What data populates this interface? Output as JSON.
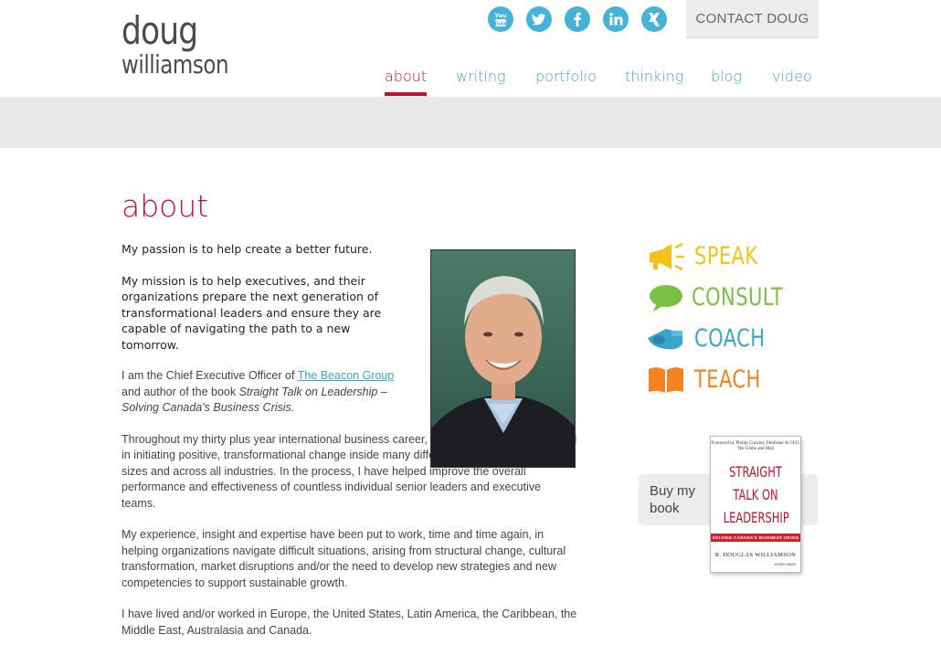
{
  "logo": {
    "line1": "doug",
    "line2": "williamson"
  },
  "social": [
    {
      "name": "youtube-icon",
      "glyph": "You Tube"
    },
    {
      "name": "twitter-icon",
      "glyph": ""
    },
    {
      "name": "facebook-icon",
      "glyph": "f"
    },
    {
      "name": "linkedin-icon",
      "glyph": "in"
    },
    {
      "name": "xing-icon",
      "glyph": ""
    }
  ],
  "contact_label": "CONTACT DOUG",
  "nav": [
    {
      "label": "about",
      "active": true
    },
    {
      "label": "writing",
      "active": false
    },
    {
      "label": "portfolio",
      "active": false
    },
    {
      "label": "thinking",
      "active": false
    },
    {
      "label": "blog",
      "active": false
    },
    {
      "label": "video",
      "active": false
    }
  ],
  "page_title": "about",
  "content": {
    "p1": "My passion is to help create a better future.",
    "p2": "My mission is to help executives, and their organizations prepare the next generation of transformational leaders and ensure they are capable of navigating the path to a new tomorrow.",
    "p3_before": "I am the Chief Executive Officer of ",
    "p3_link": "The Beacon Group",
    "p3_middle": " and author of the book ",
    "p3_book": "Straight Talk on Leadership – Solving Canada's Business Crisis.",
    "p4": "Throughout my thirty plus year international business career, I have been actively involved in initiating positive, transformational change inside many different organizations, of all sizes and across all industries. In the process, I have helped improve the overall performance and effectiveness of countless individual senior leaders and executive teams.",
    "p5": "My experience, insight and expertise have been put to work, time and time again, in helping organizations navigate difficult situations, arising from structural change, cultural transformation, market disruptions and/or the need to develop new strategies and new competencies to support sustainable growth.",
    "p6": "I have lived and/or worked in Europe, the United States, Latin America, the Caribbean, the Middle East, Australasia and Canada."
  },
  "services": [
    {
      "label": "SPEAK",
      "color": "#f2c21b",
      "icon": "megaphone-icon"
    },
    {
      "label": "CONSULT",
      "color": "#7ac143",
      "icon": "speech-bubble-icon"
    },
    {
      "label": "COACH",
      "color": "#3aa6cc",
      "icon": "whistle-icon"
    },
    {
      "label": "TEACH",
      "color": "#f58220",
      "icon": "book-icon"
    }
  ],
  "buy": {
    "label": "Buy my book"
  },
  "book_cover": {
    "foreword": "Foreword by Phillip Crawley, Publisher & CEO, The Globe and Mail",
    "title_lines": [
      "STRAIGHT",
      "TALK ON",
      "LEADERSHIP"
    ],
    "subtitle": "SOLVING CANADA'S BUSINESS CRISIS",
    "author": "R. DOUGLAS WILLIAMSON",
    "publisher": "JOSSEY-BASS"
  },
  "colors": {
    "accent_red": "#c8102e",
    "link_blue": "#3aa6cc",
    "band_grey": "#e8e8e8"
  }
}
